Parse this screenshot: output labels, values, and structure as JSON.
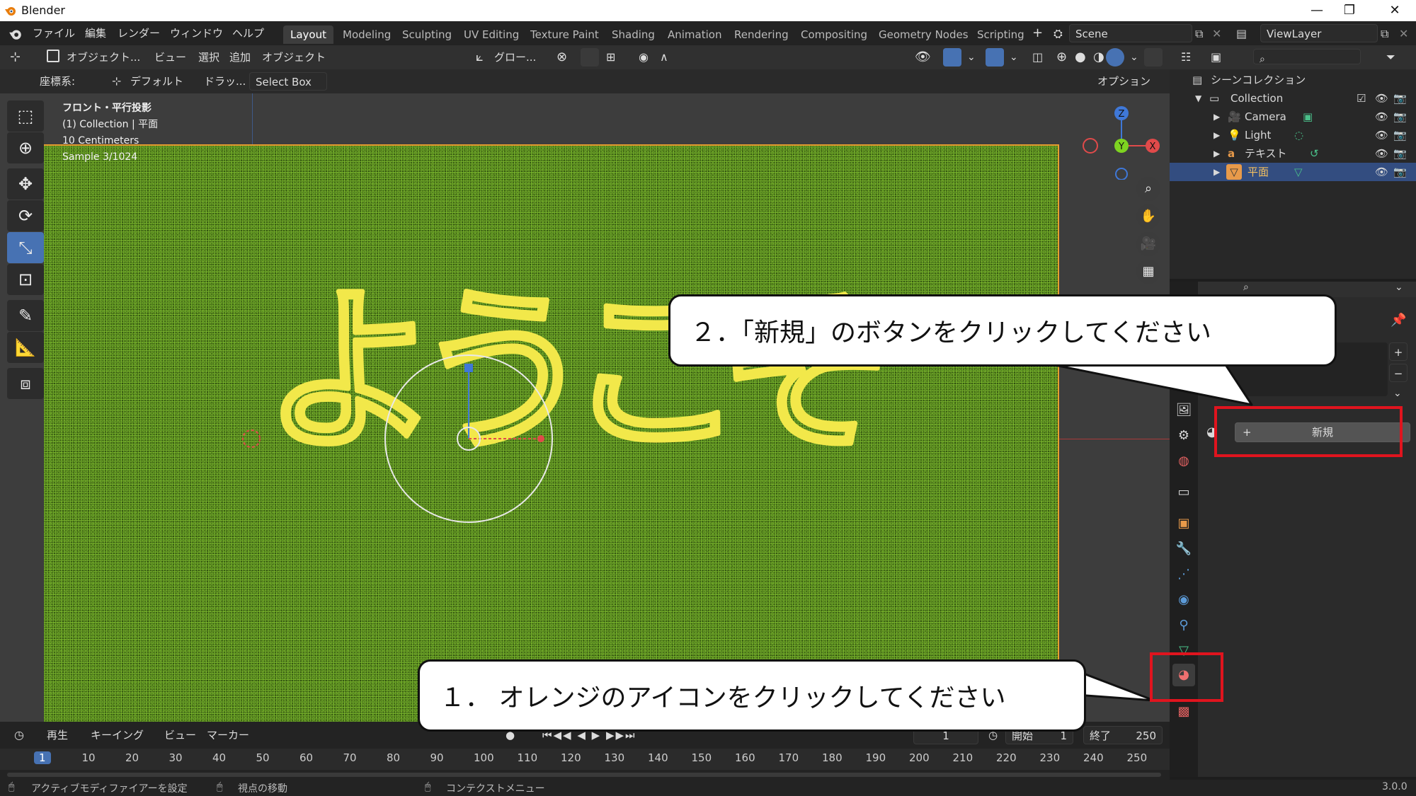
{
  "window": {
    "title": "Blender",
    "minimize": "—",
    "restore": "❐",
    "close": "✕"
  },
  "menu": [
    "ファイル",
    "編集",
    "レンダー",
    "ウィンドウ",
    "ヘルプ"
  ],
  "workspaces": [
    "Layout",
    "Modeling",
    "Sculpting",
    "UV Editing",
    "Texture Paint",
    "Shading",
    "Animation",
    "Rendering",
    "Compositing",
    "Geometry Nodes",
    "Scripting"
  ],
  "active_workspace": "Layout",
  "add_workspace": "+",
  "scene": {
    "label": "Scene"
  },
  "view_layer": {
    "label": "ViewLayer"
  },
  "viewport_header": {
    "mode": "オブジェクト...",
    "menus": [
      "ビュー",
      "選択",
      "追加",
      "オブジェクト"
    ],
    "transform": "グロー..."
  },
  "tool_header": {
    "coord_label": "座標系:",
    "coord_value": "デフォルト",
    "drag_label": "ドラッ...",
    "drag_value": "Select Box",
    "options": "オプション"
  },
  "viewport_info": {
    "line1": "フロント・平行投影",
    "line2": "(1) Collection | 平面",
    "line3": "10 Centimeters",
    "line4": "Sample 3/1024"
  },
  "viewport_text": "ようこそ",
  "gizmo": {
    "z": "Z",
    "y": "Y",
    "x": "X"
  },
  "outliner": {
    "root": "シーンコレクション",
    "collection": "Collection",
    "items": [
      "Camera",
      "Light",
      "テキスト",
      "平面"
    ]
  },
  "properties": {
    "new_button": "新規",
    "new_plus": "+",
    "slot_dots": "....",
    "add_slot": "+",
    "remove_slot": "−"
  },
  "callouts": {
    "step1": "１．  オレンジのアイコンをクリックしてください",
    "step2": "２．「新規」のボタンをクリックしてください"
  },
  "timeline": {
    "menus": [
      "再生",
      "キーイング",
      "ビュー",
      "マーカー"
    ],
    "current_frame": "1",
    "start_label": "開始",
    "start_value": "1",
    "end_label": "終了",
    "end_value": "250",
    "ticks": [
      "1",
      "10",
      "20",
      "30",
      "40",
      "50",
      "60",
      "70",
      "80",
      "90",
      "100",
      "110",
      "120",
      "130",
      "140",
      "150",
      "160",
      "170",
      "180",
      "190",
      "200",
      "210",
      "220",
      "230",
      "240",
      "250"
    ]
  },
  "status": {
    "left": "アクティブモディファイアーを設定",
    "middle": "視点の移動",
    "right": "コンテクストメニュー",
    "version": "3.0.0"
  },
  "colors": {
    "accent_blue": "#4772b3",
    "selection": "#334d80",
    "text_outline": "#f2e84a",
    "highlight_red": "#e0141e",
    "frame_orange": "#e8a030"
  }
}
